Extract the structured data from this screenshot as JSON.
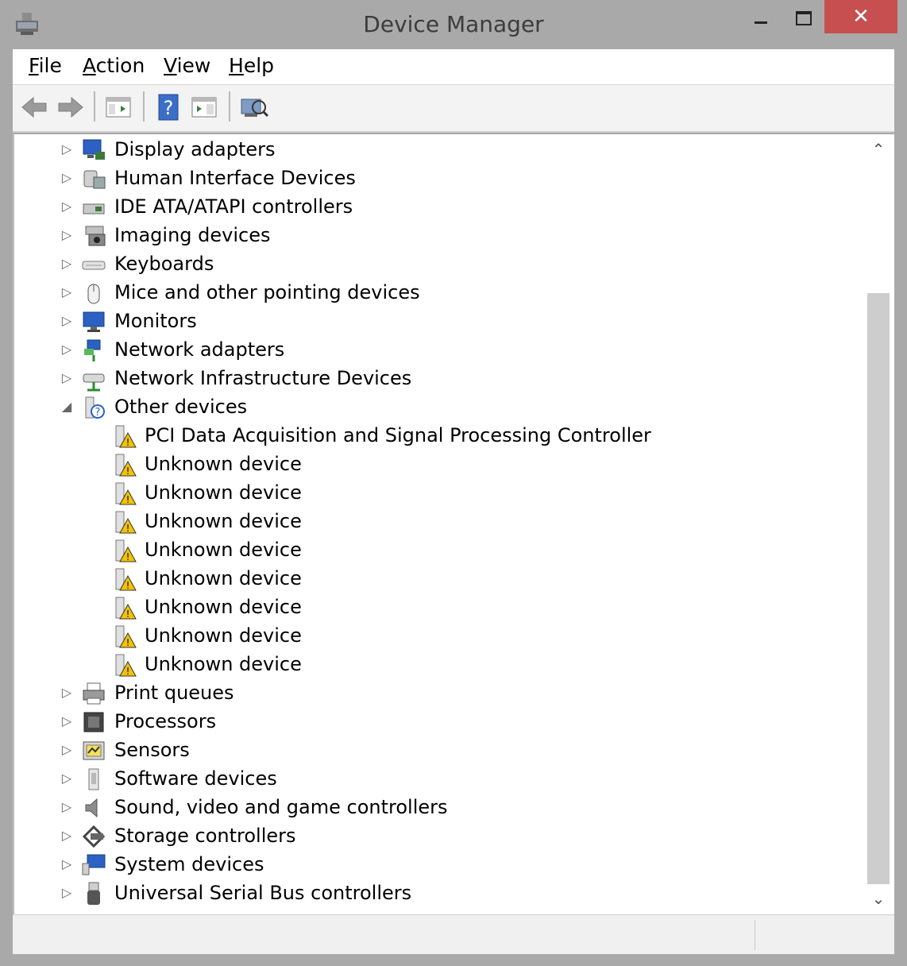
{
  "window": {
    "title": "Device Manager",
    "close_glyph": "✕"
  },
  "menu": [
    {
      "underline": "F",
      "rest": "ile"
    },
    {
      "underline": "A",
      "rest": "ction"
    },
    {
      "underline": "V",
      "rest": "iew"
    },
    {
      "underline": "H",
      "rest": "elp"
    }
  ],
  "toolbar": {
    "buttons": [
      {
        "icon": "back-arrow-icon"
      },
      {
        "icon": "forward-arrow-icon"
      },
      {
        "icon": "show-hide-console-tree-icon"
      },
      {
        "icon": "help-icon"
      },
      {
        "icon": "properties-icon"
      },
      {
        "icon": "scan-hardware-icon"
      }
    ]
  },
  "tree": {
    "items": [
      {
        "label": "Display adapters",
        "icon": "display-adapter-icon",
        "expander": "▷"
      },
      {
        "label": "Human Interface Devices",
        "icon": "hid-icon",
        "expander": "▷"
      },
      {
        "label": "IDE ATA/ATAPI controllers",
        "icon": "ide-controller-icon",
        "expander": "▷"
      },
      {
        "label": "Imaging devices",
        "icon": "camera-icon",
        "expander": "▷"
      },
      {
        "label": "Keyboards",
        "icon": "keyboard-icon",
        "expander": "▷"
      },
      {
        "label": "Mice and other pointing devices",
        "icon": "mouse-icon",
        "expander": "▷"
      },
      {
        "label": "Monitors",
        "icon": "monitor-icon",
        "expander": "▷"
      },
      {
        "label": "Network adapters",
        "icon": "network-adapter-icon",
        "expander": "▷"
      },
      {
        "label": "Network Infrastructure Devices",
        "icon": "network-infrastructure-icon",
        "expander": "▷"
      },
      {
        "label": "Other devices",
        "icon": "unknown-device-category-icon",
        "expander": "◢"
      }
    ],
    "children": [
      {
        "label": "PCI Data Acquisition and Signal Processing Controller",
        "icon": "warning-device-icon"
      },
      {
        "label": "Unknown device",
        "icon": "warning-device-icon"
      },
      {
        "label": "Unknown device",
        "icon": "warning-device-icon"
      },
      {
        "label": "Unknown device",
        "icon": "warning-device-icon"
      },
      {
        "label": "Unknown device",
        "icon": "warning-device-icon"
      },
      {
        "label": "Unknown device",
        "icon": "warning-device-icon"
      },
      {
        "label": "Unknown device",
        "icon": "warning-device-icon"
      },
      {
        "label": "Unknown device",
        "icon": "warning-device-icon"
      },
      {
        "label": "Unknown device",
        "icon": "warning-device-icon"
      }
    ],
    "after_items": [
      {
        "label": "Print queues",
        "icon": "printer-icon",
        "expander": "▷"
      },
      {
        "label": "Processors",
        "icon": "processor-icon",
        "expander": "▷"
      },
      {
        "label": "Sensors",
        "icon": "sensor-icon",
        "expander": "▷"
      },
      {
        "label": "Software devices",
        "icon": "software-device-icon",
        "expander": "▷"
      },
      {
        "label": "Sound, video and game controllers",
        "icon": "speaker-icon",
        "expander": "▷"
      },
      {
        "label": "Storage controllers",
        "icon": "storage-controller-icon",
        "expander": "▷"
      },
      {
        "label": "System devices",
        "icon": "system-device-icon",
        "expander": "▷"
      },
      {
        "label": "Universal Serial Bus controllers",
        "icon": "usb-icon",
        "expander": "▷"
      }
    ]
  },
  "scrollbar": {
    "up": "⌃",
    "down": "⌄"
  },
  "colors": {
    "close_button": "#c74f50",
    "frame": "#a9a9a9",
    "warning": "#f3c300"
  }
}
